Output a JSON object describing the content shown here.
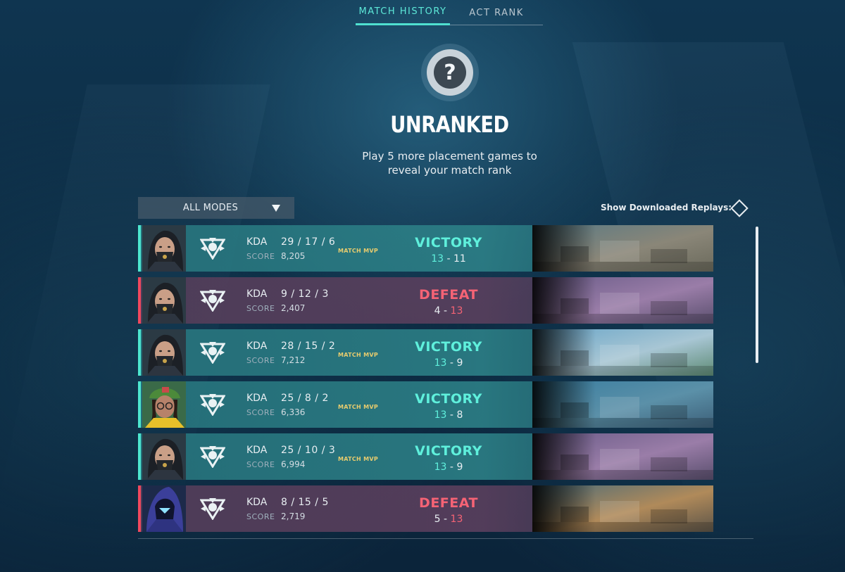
{
  "tabs": [
    {
      "label": "MATCH HISTORY",
      "active": true
    },
    {
      "label": "ACT RANK",
      "active": false
    }
  ],
  "rank": {
    "symbol": "?",
    "title": "UNRANKED",
    "description_line1": "Play 5 more placement games to",
    "description_line2": "reveal your match rank"
  },
  "filter": {
    "mode_label": "ALL MODES",
    "replays_label": "Show Downloaded Replays:"
  },
  "kda_label": "KDA",
  "score_label": "SCORE",
  "matches": [
    {
      "agent": "masked-duelist",
      "outcome": "win",
      "result": "VICTORY",
      "kda": "29 / 17 / 6",
      "score": "8,205",
      "mvp": "MATCH MVP",
      "team_score": "13",
      "enemy_score": "11",
      "map": "city"
    },
    {
      "agent": "masked-duelist",
      "outcome": "loss",
      "result": "DEFEAT",
      "kda": "9 / 12 / 3",
      "score": "2,407",
      "mvp": "",
      "team_score": "4",
      "enemy_score": "13",
      "map": "ruins"
    },
    {
      "agent": "masked-duelist",
      "outcome": "win",
      "result": "VICTORY",
      "kda": "28 / 15 / 2",
      "score": "7,212",
      "mvp": "MATCH MVP",
      "team_score": "13",
      "enemy_score": "9",
      "map": "coast"
    },
    {
      "agent": "green-beanie",
      "outcome": "win",
      "result": "VICTORY",
      "kda": "25 / 8 / 2",
      "score": "6,336",
      "mvp": "MATCH MVP",
      "team_score": "13",
      "enemy_score": "8",
      "map": "harbor"
    },
    {
      "agent": "masked-duelist",
      "outcome": "win",
      "result": "VICTORY",
      "kda": "25 / 10 / 3",
      "score": "6,994",
      "mvp": "MATCH MVP",
      "team_score": "13",
      "enemy_score": "9",
      "map": "ruins"
    },
    {
      "agent": "hooded-shadow",
      "outcome": "loss",
      "result": "DEFEAT",
      "kda": "8 / 15 / 5",
      "score": "2,719",
      "mvp": "",
      "team_score": "5",
      "enemy_score": "13",
      "map": "desert"
    }
  ],
  "colors": {
    "accent_teal": "#4de6cf",
    "victory": "#5ff0dc",
    "defeat": "#f56375",
    "mvp_gold": "#e8cc6e"
  }
}
